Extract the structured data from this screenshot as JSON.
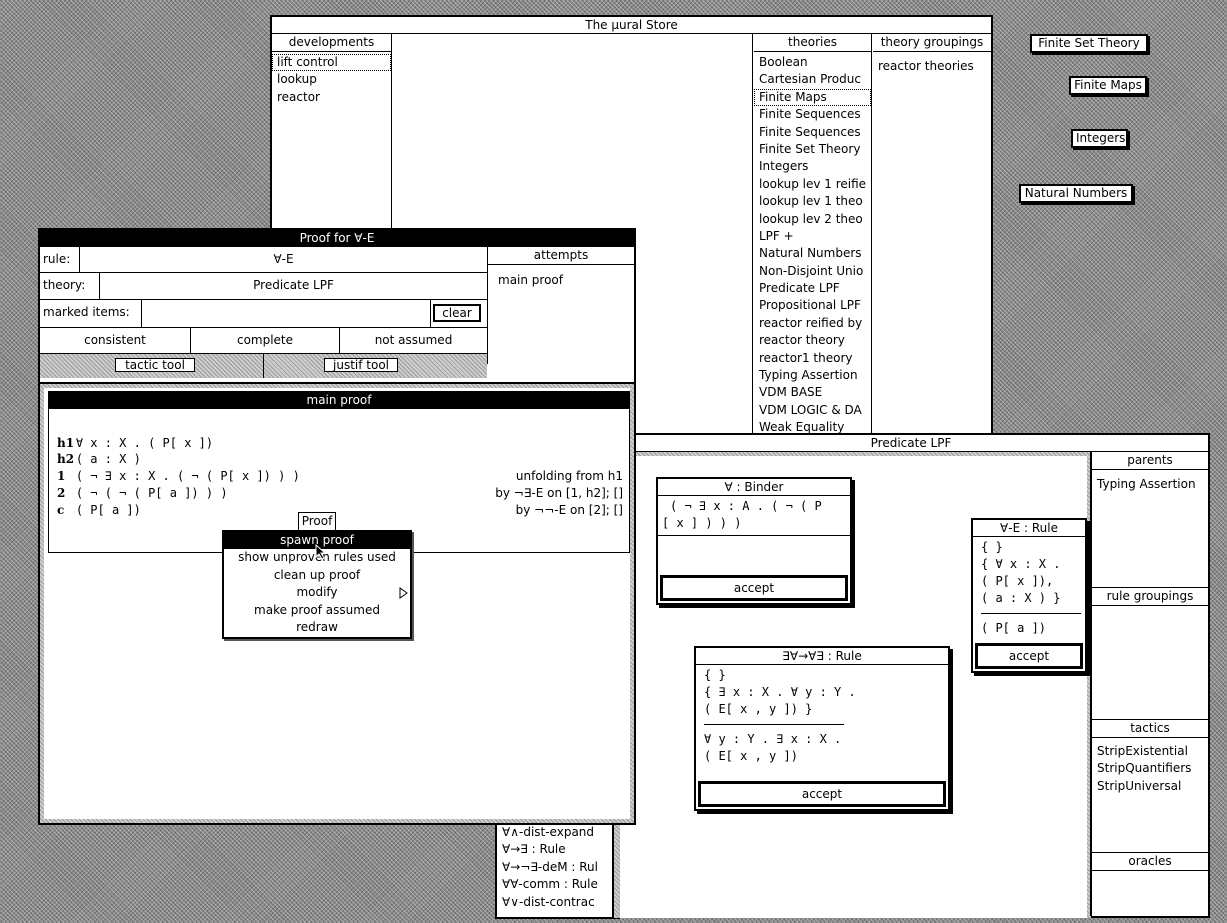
{
  "store": {
    "title": "The µural Store",
    "developments_header": "developments",
    "developments": [
      "lift control",
      "lookup",
      "reactor"
    ],
    "theories_header": "theories",
    "theories": [
      "Boolean",
      "Cartesian Produc",
      "Finite Maps",
      "Finite Sequences",
      "Finite Sequences",
      "Finite Set Theory",
      "Integers",
      "lookup lev 1 reifie",
      "lookup lev 1 theo",
      "lookup lev 2 theo",
      "LPF +",
      "Natural Numbers",
      "Non-Disjoint Unio",
      "Predicate LPF",
      "Propositional LPF",
      "reactor reified by",
      "reactor theory",
      "reactor1 theory",
      "Typing Assertion",
      "VDM BASE",
      "VDM LOGIC & DA",
      "Weak Equality"
    ],
    "groupings_header": "theory groupings",
    "groupings": [
      "reactor theories"
    ]
  },
  "desktop_buttons": [
    "Finite Set Theory",
    "Finite Maps",
    "Integers",
    "Natural Numbers"
  ],
  "proof_window": {
    "title": "Proof for ∀-E",
    "rule_label": "rule:",
    "rule_value": "∀-E",
    "theory_label": "theory:",
    "theory_value": "Predicate LPF",
    "marked_label": "marked items:",
    "marked_value": "",
    "clear_label": "clear",
    "status": [
      "consistent",
      "complete",
      "not assumed"
    ],
    "tactic_tool": "tactic tool",
    "justif_tool": "justif tool",
    "attempts_header": "attempts",
    "attempts": [
      "main proof"
    ]
  },
  "main_proof": {
    "title": "main proof",
    "lines": [
      {
        "label": "h1",
        "formula": "∀ x : X . ( P[ x ])",
        "just": ""
      },
      {
        "label": "h2",
        "formula": "( a : X )",
        "just": ""
      },
      {
        "label": "1",
        "formula": "( ¬ ∃ x : X . ( ¬ ( P[ x ]) ) )",
        "just": "unfolding from h1"
      },
      {
        "label": "2",
        "formula": "( ¬ ( ¬ ( P[ a ]) ) )",
        "just": "by ¬∃-E on [1, h2]; []"
      },
      {
        "label": "c",
        "formula": "( P[ a ])",
        "just": "by ¬¬-E on [2]; []"
      }
    ],
    "proof_button": "Proof"
  },
  "context_menu": {
    "items": [
      "spawn proof",
      "show unproven rules used",
      "clean up proof",
      "modify",
      "make proof assumed",
      "redraw"
    ],
    "highlighted": "spawn proof",
    "submenu_item": "modify"
  },
  "lower_list": [
    "∀∧-dist-expand",
    "∀→∃ : Rule",
    "∀→¬∃-deM : Rul",
    "∀∀-comm : Rule",
    "∀∨-dist-contrac"
  ],
  "theory_window": {
    "title": "Predicate LPF",
    "parents_header": "parents",
    "parents": [
      "Typing Assertion"
    ],
    "rule_groupings_header": "rule groupings",
    "tactics_header": "tactics",
    "tactics": [
      "StripExistential",
      "StripQuantifiers",
      "StripUniversal"
    ],
    "oracles_header": "oracles"
  },
  "cards": {
    "binder": {
      "title": "∀ : Binder",
      "lines": [
        "( ¬ ∃ x : A . ( ¬ ( P",
        "[ x ] ) ) )"
      ],
      "accept": "accept"
    },
    "forall_e": {
      "title": "∀-E : Rule",
      "lines": [
        "{ }",
        "{ ∀ x : X .",
        "( P[ x ]),",
        "( a : X ) }"
      ],
      "conclusion": "( P[ a ])",
      "accept": "accept"
    },
    "exists_forall": {
      "title": "∃∀→∀∃ : Rule",
      "lines": [
        "{ }",
        "{ ∃ x : X . ∀ y : Y .",
        "( E[ x , y ]) }"
      ],
      "conclusion": [
        "∀ y : Y . ∃ x : X .",
        "( E[ x , y ])"
      ],
      "accept": "accept"
    }
  }
}
